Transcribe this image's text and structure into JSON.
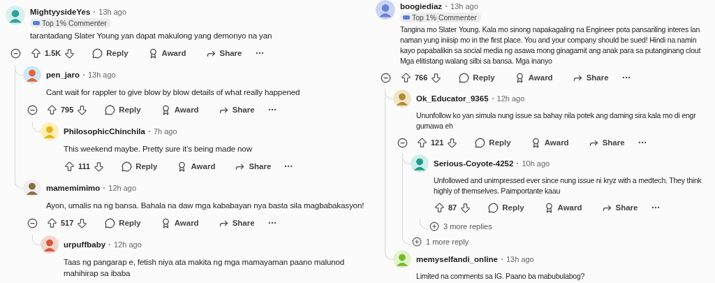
{
  "columns": [
    {
      "comments": [
        {
          "author": "MightyysideYes",
          "time": "13h ago",
          "badge": "Top 1% Commenter",
          "lines": [
            "tarantadang Slater Young yan dapat makulong yang demonyo na yan"
          ],
          "votes": "1.5K",
          "reply": "Reply",
          "award": "Award",
          "share": "Share",
          "children": [
            {
              "author": "pen_jaro",
              "time": "13h ago",
              "lines": [
                "Cant wait for rappler to give blow by blow details of what really happened"
              ],
              "votes": "795",
              "reply": "Reply",
              "award": "Award",
              "share": "Share",
              "children": [
                {
                  "author": "PhilosophicChinchila",
                  "time": "7h ago",
                  "lines": [
                    "This weekend maybe. Pretty sure it’s being made now"
                  ],
                  "votes": "111",
                  "reply": "Reply",
                  "award": "Award",
                  "share": "Share"
                }
              ]
            },
            {
              "author": "mamemimimo",
              "time": "12h ago",
              "lines": [
                "Ayon, umalis na ng bansa. Bahala na daw mga kababayan nya basta sila magbabakasyon!"
              ],
              "votes": "517",
              "reply": "Reply",
              "award": "Award",
              "share": "Share",
              "children": [
                {
                  "author": "urpuffbaby",
                  "time": "12h ago",
                  "lines": [
                    "Taas ng pangarap e, fetish niya ata makita ng mga mamayaman paano malunod",
                    "mahihirap sa ibaba"
                  ]
                }
              ]
            }
          ]
        }
      ]
    },
    {
      "comments": [
        {
          "author": "boogiediaz",
          "time": "13h ago",
          "badge": "Top 1% Commenter",
          "lines": [
            "Tangina mo Slater Young. Kala mo sinong napakagaling na Engineer pota pansariling interes lan",
            "naman yung iniisip mo in the first place. You and your company should be sued! Hindi na namin",
            "kayo papabalikin sa social media ng asawa mong ginagamit ang anak para sa putanginang clout",
            "Mga elitistang walang silbi sa bansa. Mga inanyo"
          ],
          "votes": "766",
          "reply": "Reply",
          "award": "Award",
          "share": "Share",
          "children": [
            {
              "author": "Ok_Educator_9365",
              "time": "12h ago",
              "lines": [
                "Ununfollow ko yan simula nung issue sa bahay nila potek ang daming sira kala mo di engr",
                "gumawa eh"
              ],
              "votes": "121",
              "reply": "Reply",
              "award": "Award",
              "share": "Share",
              "more_replies": "1 more reply",
              "children": [
                {
                  "author": "Serious-Coyote-4252",
                  "time": "10h ago",
                  "lines": [
                    "Unfollowed and unimpressed ever since nung issue ni kryz with a medtech. They think",
                    "highly of themselves. Paimportante kaau"
                  ],
                  "votes": "87",
                  "reply": "Reply",
                  "award": "Award",
                  "share": "Share",
                  "more_replies": "3 more replies"
                }
              ]
            },
            {
              "author": "memyselfandi_online",
              "time": "13h ago",
              "lines": [
                "Limited na comments sa IG. Paano ba mabubulabog?"
              ]
            }
          ]
        }
      ]
    }
  ]
}
